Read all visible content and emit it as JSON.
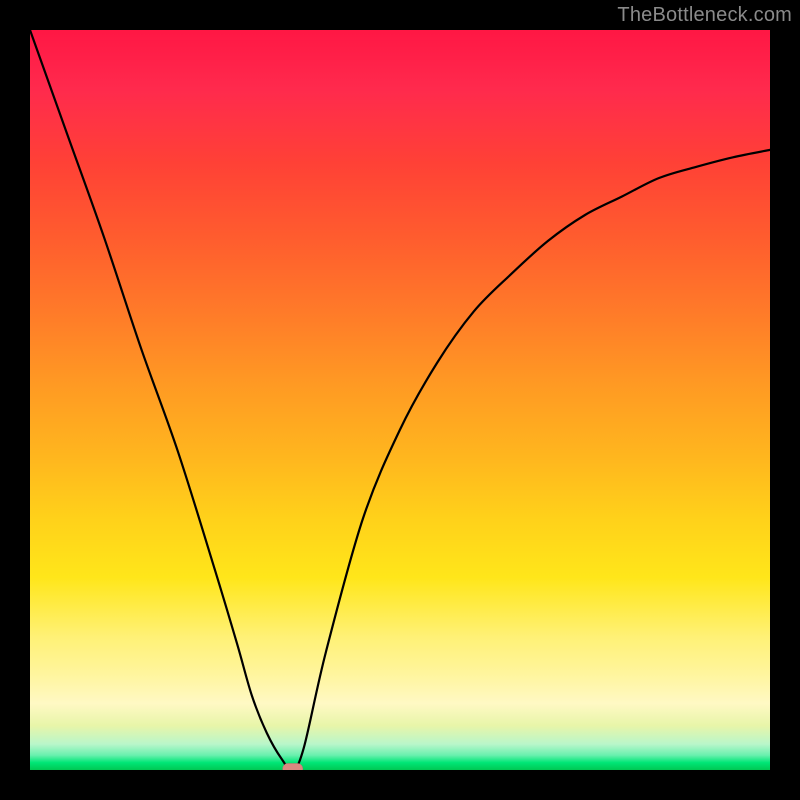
{
  "watermark": "TheBottleneck.com",
  "chart_data": {
    "type": "line",
    "title": "",
    "xlabel": "",
    "ylabel": "",
    "xlim": [
      0,
      1
    ],
    "ylim": [
      0,
      1
    ],
    "grid": false,
    "legend": false,
    "background_gradient": {
      "direction": "vertical",
      "stops": [
        {
          "pos": 0.0,
          "color": "#ff1744"
        },
        {
          "pos": 0.5,
          "color": "#ffb300"
        },
        {
          "pos": 0.8,
          "color": "#ffee58"
        },
        {
          "pos": 0.95,
          "color": "#c5e1a5"
        },
        {
          "pos": 1.0,
          "color": "#00c853"
        }
      ]
    },
    "series": [
      {
        "name": "bottleneck-curve",
        "x": [
          0.0,
          0.05,
          0.1,
          0.15,
          0.2,
          0.25,
          0.28,
          0.3,
          0.32,
          0.34,
          0.355,
          0.37,
          0.4,
          0.45,
          0.5,
          0.55,
          0.6,
          0.65,
          0.7,
          0.75,
          0.8,
          0.85,
          0.9,
          0.95,
          1.0
        ],
        "y": [
          1.0,
          0.86,
          0.72,
          0.57,
          0.43,
          0.27,
          0.17,
          0.1,
          0.05,
          0.015,
          0.0,
          0.03,
          0.16,
          0.34,
          0.46,
          0.55,
          0.62,
          0.67,
          0.715,
          0.75,
          0.775,
          0.8,
          0.815,
          0.828,
          0.838
        ]
      }
    ],
    "marker": {
      "name": "optimal-point",
      "x": 0.355,
      "y": 0.0,
      "shape": "rounded-pill",
      "color": "#d98880"
    }
  }
}
